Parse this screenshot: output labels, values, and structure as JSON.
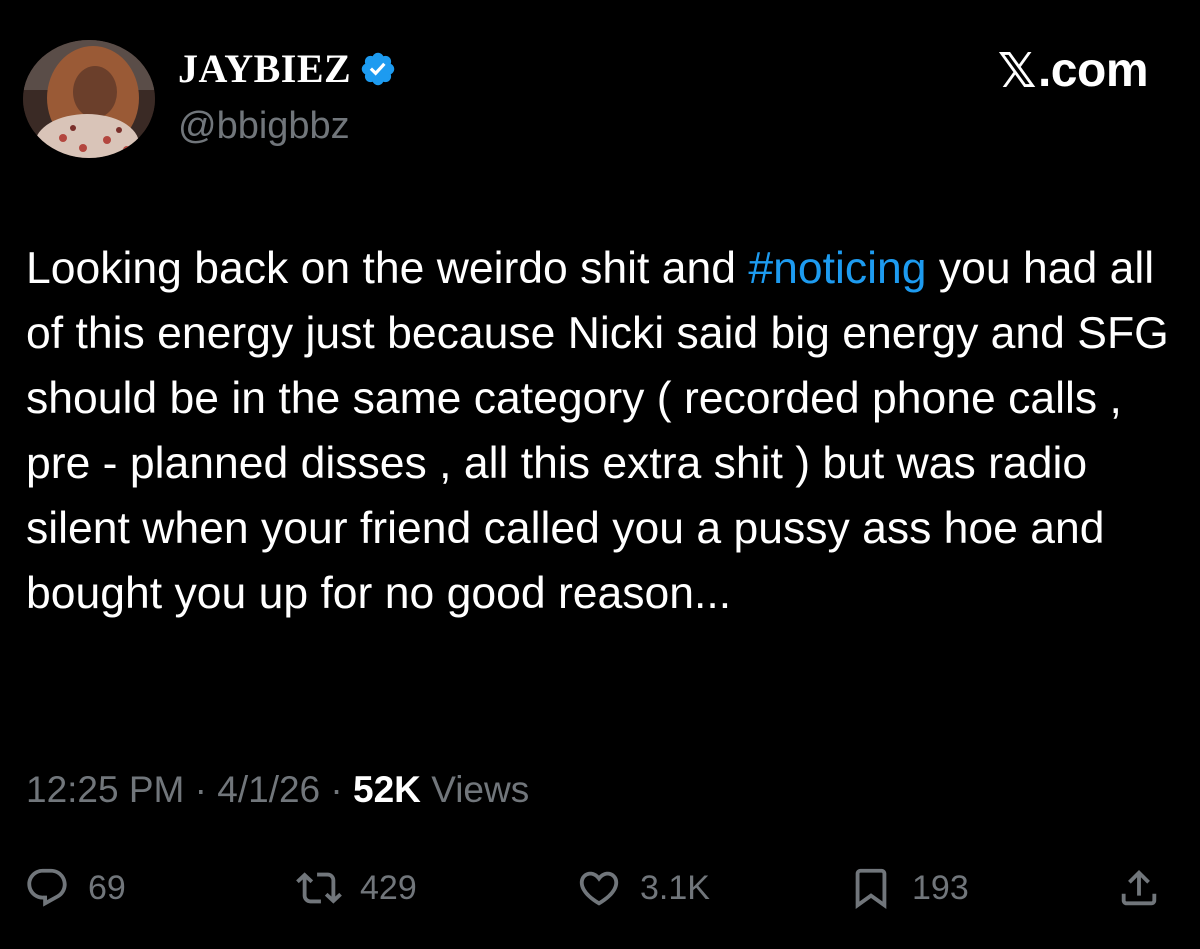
{
  "author": {
    "display_name": "JAYBIEZ",
    "handle": "@bbigbbz",
    "verified": true
  },
  "brand": {
    "symbol": "𝕏",
    "suffix": ".com"
  },
  "tweet": {
    "text_before": "Looking back on the weirdo shit and ",
    "hashtag": "#noticing",
    "text_after": " you had all of this energy just because Nicki said big energy and SFG should be in the same category ( recorded phone calls , pre - planned disses , all this extra shit ) but was radio silent when your friend called you a pussy ass hoe and bought you up for no good reason..."
  },
  "meta": {
    "time": "12:25 PM",
    "separator": " · ",
    "date": "4/1/26",
    "views_count": "52K",
    "views_label": " Views"
  },
  "actions": {
    "replies": "69",
    "reposts": "429",
    "likes": "3.1K",
    "bookmarks": "193"
  },
  "icons": {
    "verified": "verified-badge-icon",
    "reply": "reply-icon",
    "repost": "repost-icon",
    "like": "heart-icon",
    "bookmark": "bookmark-icon",
    "share": "share-icon"
  },
  "colors": {
    "background": "#000000",
    "text": "#ffffff",
    "secondary": "#71767b",
    "link": "#1d9bf0"
  }
}
